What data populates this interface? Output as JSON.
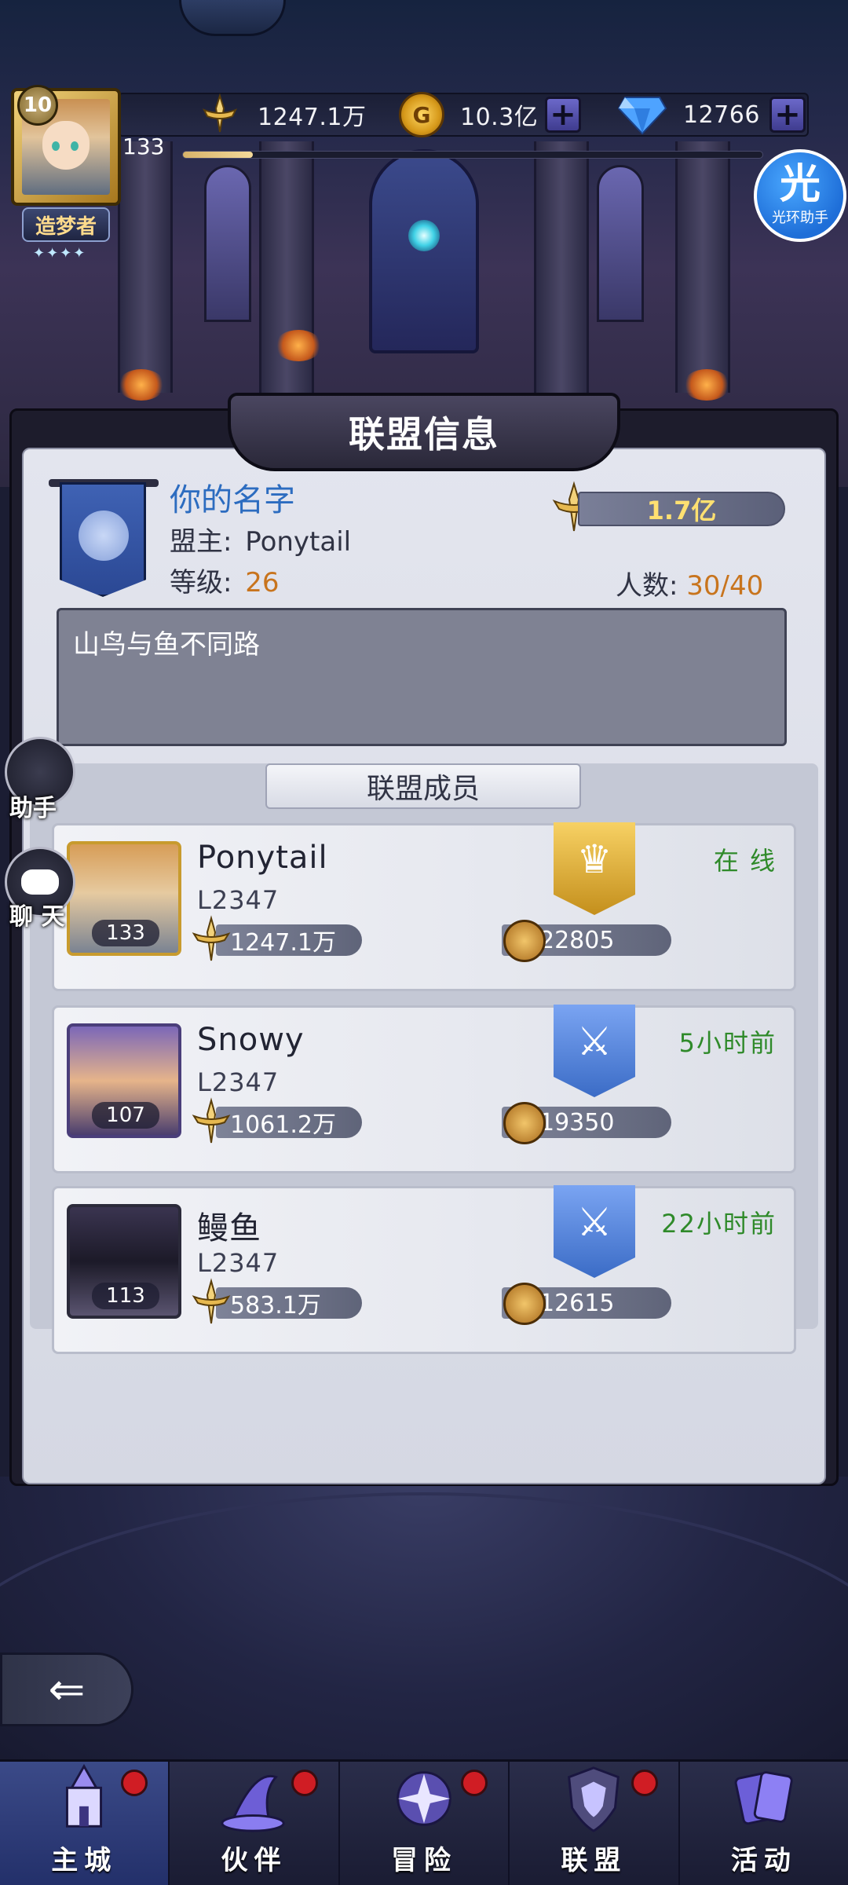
{
  "hud": {
    "player_level": "10",
    "player_rank_value": "133",
    "title_badge": "造梦者",
    "power": "1247.1万",
    "gold": "10.3亿",
    "diamonds": "12766",
    "xp_fraction": 0.12,
    "helper_button": {
      "big": "光",
      "small": "光环助手"
    }
  },
  "panel": {
    "title": "联盟信息",
    "guild_name": "你的名字",
    "owner_label": "盟主:",
    "owner_value": "Ponytail",
    "level_label": "等级:",
    "level_value": "26",
    "power": "1.7亿",
    "members_label": "人数:",
    "members_value": "30/40",
    "notice": "山鸟与鱼不同路"
  },
  "members": {
    "header": "联盟成员",
    "list": [
      {
        "name": "Ponytail",
        "id": "L2347",
        "level": "133",
        "power": "1247.1万",
        "contribution": "22805",
        "status": "在 线",
        "rank_icon": "crown-icon"
      },
      {
        "name": "Snowy",
        "id": "L2347",
        "level": "107",
        "power": "1061.2万",
        "contribution": "19350",
        "status": "5小时前",
        "rank_icon": "crossed-swords-icon"
      },
      {
        "name": "鳗鱼",
        "id": "L2347",
        "level": "113",
        "power": "583.1万",
        "contribution": "12615",
        "status": "22小时前",
        "rank_icon": "crossed-swords-icon"
      }
    ]
  },
  "floating": {
    "assistant": "助手",
    "chat": "聊 天"
  },
  "nav": [
    {
      "label": "主城",
      "badge": true,
      "active": true
    },
    {
      "label": "伙伴",
      "badge": true,
      "active": false
    },
    {
      "label": "冒险",
      "badge": true,
      "active": false
    },
    {
      "label": "联盟",
      "badge": true,
      "active": false
    },
    {
      "label": "活动",
      "badge": false,
      "active": false
    }
  ],
  "colors": {
    "accent_blue": "#2c6cc0",
    "value_orange": "#c8741d",
    "status_green": "#2f8a2a",
    "badge_red": "#d01d24"
  }
}
